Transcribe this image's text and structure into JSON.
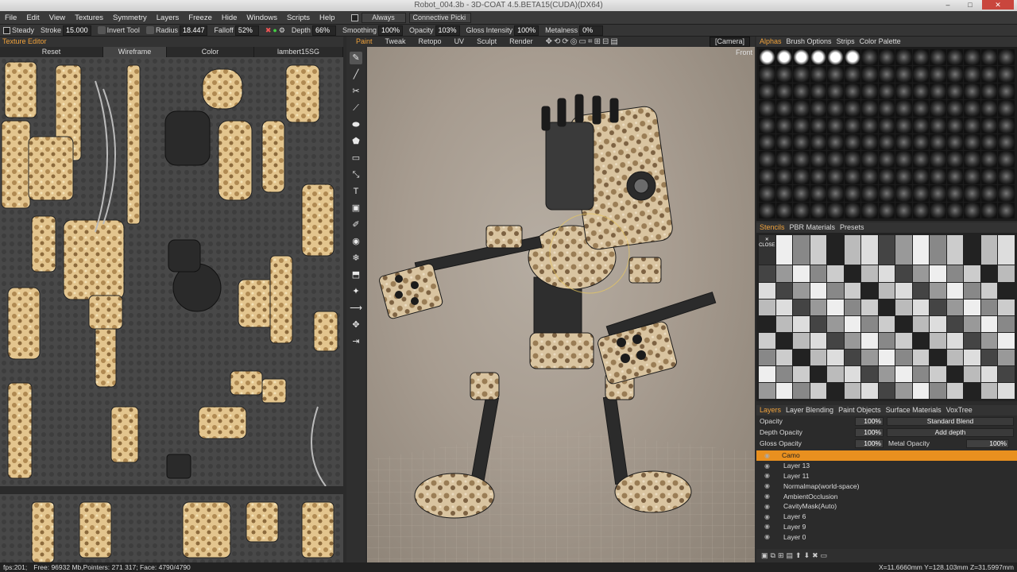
{
  "window": {
    "title": "Robot_004.3b - 3D-COAT 4.5.BETA15(CUDA)(DX64)",
    "controls": [
      "–",
      "□",
      "✕"
    ]
  },
  "menu": {
    "items": [
      "File",
      "Edit",
      "View",
      "Textures",
      "Symmetry",
      "Layers",
      "Freeze",
      "Hide",
      "Windows",
      "Scripts",
      "Help"
    ],
    "mode_value": "Always",
    "picking_value": "Connective Picki"
  },
  "toolbar": {
    "steady_label": "Steady",
    "stroke_label": "Stroke",
    "stroke_value": "15.000",
    "invert_tool_label": "Invert Tool",
    "radius_label": "Radius",
    "radius_value": "18.447",
    "falloff_label": "Falloff",
    "falloff_value": "52%",
    "depth_label": "Depth",
    "depth_value": "66%",
    "smoothing_label": "Smoothing",
    "smoothing_value": "100%",
    "opacity_label": "Opacity",
    "opacity_value": "103%",
    "gloss_label": "Gloss",
    "intensity_label": "Intensity",
    "intensity_value": "100%",
    "metalness_label": "Metalness",
    "metalness_value": "0%"
  },
  "texture_editor": {
    "title": "Texture Editor",
    "reset": "Reset",
    "wireframe": "Wireframe",
    "color": "Color",
    "material": "lambert15SG"
  },
  "rooms": {
    "tabs": [
      "Paint",
      "Tweak",
      "Retopo",
      "UV",
      "Sculpt",
      "Render"
    ],
    "active": "Paint",
    "camera": "[Camera]"
  },
  "viewport": {
    "view_label": "Front"
  },
  "tools": [
    "✎",
    "╱",
    "✂",
    "⟋",
    "⬬",
    "⬟",
    "▭",
    "⤡",
    "T",
    "▣",
    "✐",
    "◉",
    "❄",
    "⬒",
    "✦",
    "⟶",
    "✥",
    "⇥"
  ],
  "alphas_panel": {
    "tabs": [
      "Alphas",
      "Brush Options",
      "Strips",
      "Color Palette"
    ],
    "active": "Alphas"
  },
  "stencils_panel": {
    "tabs": [
      "Stencils",
      "PBR Materials",
      "Presets"
    ],
    "active": "Stencils",
    "close_label": "CLOSE"
  },
  "layers_panel": {
    "tabs": [
      "Layers",
      "Layer Blending",
      "Paint Objects",
      "Surface Materials",
      "VoxTree"
    ],
    "active": "Layers",
    "opacity_label": "Opacity",
    "opacity_value": "100%",
    "blend_mode": "Standard Blend",
    "depth_opacity_label": "Depth Opacity",
    "depth_opacity_value": "100%",
    "depth_mode": "Add depth",
    "gloss_opacity_label": "Gloss Opacity",
    "gloss_opacity_value": "100%",
    "metal_opacity_label": "Metal Opacity",
    "metal_opacity_value": "100%",
    "layers": [
      "Camo",
      "Layer 13",
      "Layer 11",
      "Normalmap(world-space)",
      "AmbientOcclusion",
      "CavityMask(Auto)",
      "Layer 6",
      "Layer 9",
      "Layer 0"
    ],
    "active_layer": "Camo"
  },
  "status": {
    "fps": "fps:201;",
    "memory": "Free: 96932 Mb,Pointers: 271 317; Face: 4790/4790",
    "coords": "X=11.6660mm  Y=128.103mm  Z=31.5997mm"
  },
  "colors": {
    "accent": "#f0a23c",
    "active_layer": "#e9901f",
    "panel_bg": "#2b2b2b"
  }
}
